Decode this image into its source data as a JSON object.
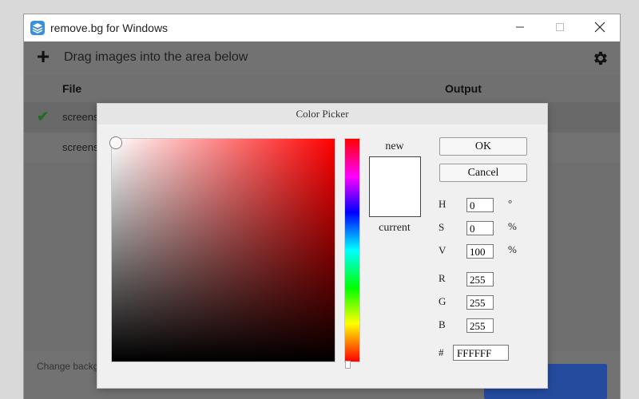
{
  "window": {
    "title": "remove.bg for Windows",
    "minimize_icon": "minimize-icon",
    "maximize_icon": "maximize-icon",
    "close_icon": "close-icon"
  },
  "toolbar": {
    "add_symbol": "+",
    "drag_text": "Drag images into the area below",
    "gear_icon": "gear-icon"
  },
  "table": {
    "headers": {
      "file": "File",
      "output": "Output"
    },
    "rows": [
      {
        "check": "✔",
        "file": "screens"
      },
      {
        "check": "",
        "file": "screens"
      }
    ]
  },
  "bottom": {
    "change_background": "Change backg"
  },
  "color_picker": {
    "title": "Color Picker",
    "new_label": "new",
    "current_label": "current",
    "ok_label": "OK",
    "cancel_label": "Cancel",
    "fields": {
      "h": {
        "label": "H",
        "value": "0",
        "unit": "°"
      },
      "s": {
        "label": "S",
        "value": "0",
        "unit": "%"
      },
      "v": {
        "label": "V",
        "value": "100",
        "unit": "%"
      },
      "r": {
        "label": "R",
        "value": "255"
      },
      "g": {
        "label": "G",
        "value": "255"
      },
      "b": {
        "label": "B",
        "value": "255"
      }
    },
    "hex": {
      "label": "#",
      "value": "FFFFFF"
    },
    "new_color": "#ffffff",
    "current_color": "#ffffff",
    "hue_base": "#ff0000"
  }
}
